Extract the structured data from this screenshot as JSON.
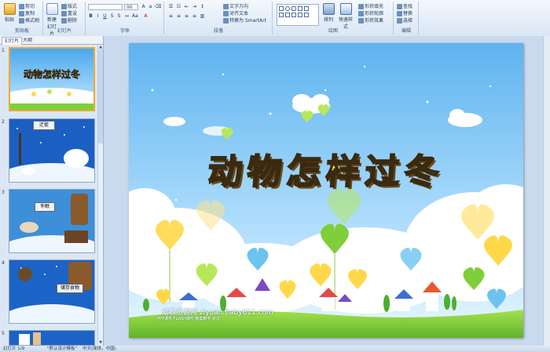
{
  "ribbon": {
    "clipboard": {
      "label": "剪贴板",
      "paste": "粘贴",
      "cut": "剪切",
      "copy": "复制",
      "format_painter": "格式刷"
    },
    "slides": {
      "label": "幻灯片",
      "new_slide": "新建\n幻灯片",
      "layout": "版式",
      "reset": "重设",
      "delete": "删除"
    },
    "font": {
      "label": "字体",
      "font_size": "96"
    },
    "paragraph": {
      "label": "段落",
      "text_direction": "文字方向",
      "align_text": "对齐文本",
      "smartart": "转换为 SmartArt"
    },
    "drawing": {
      "label": "绘图",
      "arrange": "排列",
      "quick_styles": "快速样式",
      "shape_fill": "形状填充",
      "shape_outline": "形状轮廓",
      "shape_effects": "形状效果"
    },
    "editing": {
      "label": "编辑",
      "find": "查找",
      "replace": "替换",
      "select": "选择"
    }
  },
  "pane": {
    "tabs": [
      "幻灯片",
      "大纲"
    ],
    "slides": [
      {
        "num": "1",
        "title": "动物怎样过冬"
      },
      {
        "num": "2",
        "label": "迁徙"
      },
      {
        "num": "3",
        "label": "冬眠"
      },
      {
        "num": "4",
        "label": "储存食物"
      },
      {
        "num": "5"
      }
    ]
  },
  "slide": {
    "title": "动物怎样过冬",
    "site": "幼教资源网 ziyuan.baby611.com",
    "site_sub": "PPT课件 FLASH课件 教案教学 论文"
  },
  "status": {
    "slide_info": "幻灯片 1/9",
    "theme": "\"默认设计模板\"",
    "language": "中文(简体，中国)"
  },
  "colors": {
    "title_fill": "#ffe94a",
    "sky_top": "#5eb3ef",
    "grass": "#7fce3a"
  }
}
